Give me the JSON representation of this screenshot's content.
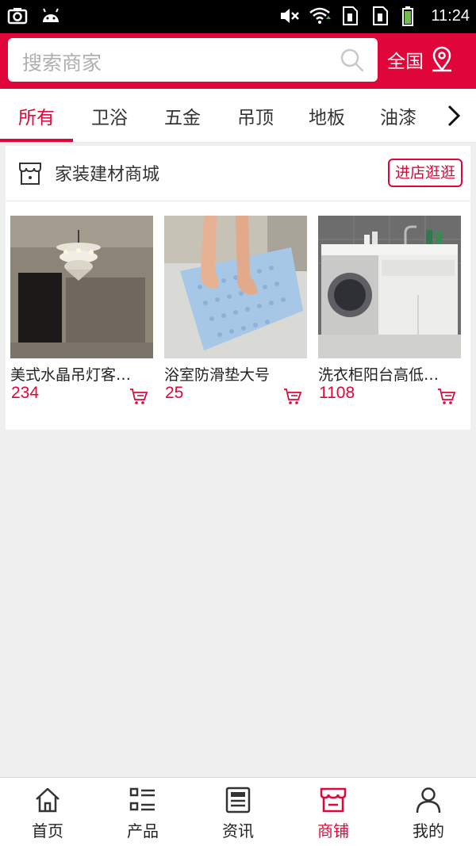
{
  "status_bar": {
    "time": "11:24",
    "left_icons": [
      "screenshot-icon",
      "android-icon"
    ],
    "right_icons": [
      "mute-icon",
      "wifi-icon",
      "sim1-icon",
      "sim2-icon",
      "battery-icon"
    ]
  },
  "header": {
    "search_placeholder": "搜索商家",
    "region_label": "全国",
    "accent_color": "#e1063a"
  },
  "tabs": [
    {
      "label": "所有",
      "active": true
    },
    {
      "label": "卫浴",
      "active": false
    },
    {
      "label": "五金",
      "active": false
    },
    {
      "label": "吊顶",
      "active": false
    },
    {
      "label": "地板",
      "active": false
    },
    {
      "label": "油漆",
      "active": false
    }
  ],
  "shop": {
    "name": "家装建材商城",
    "enter_label": "进店逛逛",
    "products": [
      {
        "name": "美式水晶吊灯客…",
        "price": "234"
      },
      {
        "name": "浴室防滑垫大号",
        "price": "25"
      },
      {
        "name": "洗衣柜阳台高低…",
        "price": "1108"
      }
    ]
  },
  "bottom_nav": [
    {
      "label": "首页",
      "icon": "home-icon",
      "active": false
    },
    {
      "label": "产品",
      "icon": "list-icon",
      "active": false
    },
    {
      "label": "资讯",
      "icon": "news-icon",
      "active": false
    },
    {
      "label": "商铺",
      "icon": "store-icon",
      "active": true
    },
    {
      "label": "我的",
      "icon": "user-icon",
      "active": false
    }
  ]
}
